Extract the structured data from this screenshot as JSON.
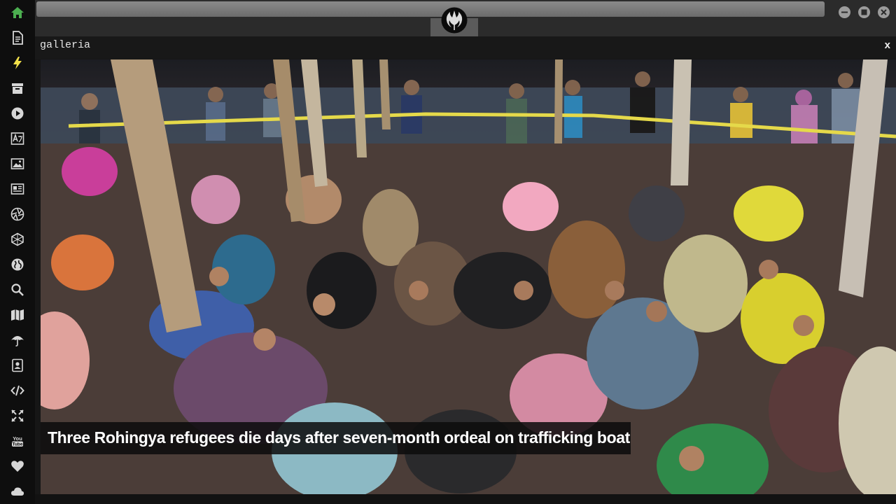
{
  "sidebar": {
    "items": [
      {
        "icon": "home-icon",
        "color": "#4caf50"
      },
      {
        "icon": "document-icon"
      },
      {
        "icon": "lightning-icon",
        "color": "#f2e14a"
      },
      {
        "icon": "archive-icon"
      },
      {
        "icon": "play-icon"
      },
      {
        "icon": "translate-icon"
      },
      {
        "icon": "image-icon"
      },
      {
        "icon": "newspaper-icon"
      },
      {
        "icon": "aperture-icon"
      },
      {
        "icon": "hexagon-icon"
      },
      {
        "icon": "globe-icon"
      },
      {
        "icon": "search-icon"
      },
      {
        "icon": "map-icon"
      },
      {
        "icon": "umbrella-icon"
      },
      {
        "icon": "contact-icon"
      },
      {
        "icon": "code-icon"
      },
      {
        "icon": "expand-icon"
      },
      {
        "icon": "youtube-icon"
      },
      {
        "icon": "heart-icon"
      },
      {
        "icon": "cloud-icon"
      }
    ]
  },
  "window": {
    "logo_icon": "rebel-alliance-icon",
    "controls": [
      "minimize-icon",
      "maximize-icon",
      "close-icon"
    ]
  },
  "panel": {
    "title": "galleria",
    "close_label": "x"
  },
  "gallery": {
    "caption": "Three Rohingya refugees die days after seven-month ordeal on trafficking boat"
  },
  "colors": {
    "sidebar_bg": "#0e0e0e",
    "icon_default": "#d6d6d6",
    "home_icon": "#4caf50",
    "lightning_icon": "#f2e14a",
    "topbar_bg": "#2b2b2b"
  }
}
